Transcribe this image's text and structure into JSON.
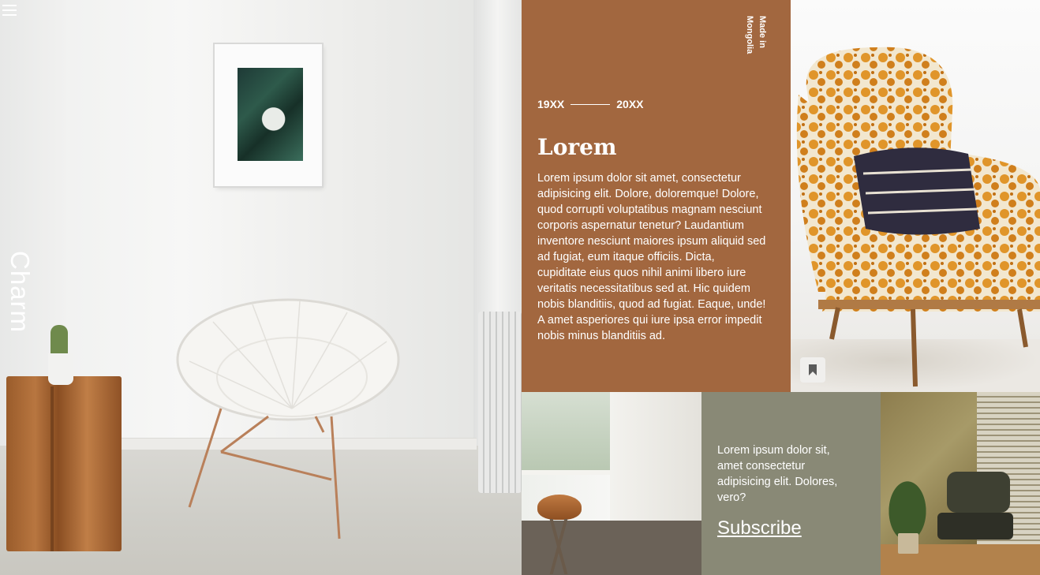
{
  "nav": {
    "menu_icon": "hamburger-menu-icon"
  },
  "hero": {
    "vertical_label": "Charm"
  },
  "info": {
    "made_in": "Made in Mongolia",
    "year_start": "19XX",
    "year_end": "20XX",
    "title": "Lorem",
    "body": "Lorem ipsum dolor sit amet, consectetur adipisicing elit. Dolore, doloremque! Dolore, quod corrupti voluptatibus magnam nesciunt corporis aspernatur tenetur? Laudantium inventore nesciunt maiores ipsum aliquid sed ad fugiat, eum itaque officiis. Dicta, cupiditate eius quos nihil animi libero iure veritatis necessitatibus sed at. Hic quidem nobis blanditiis, quod ad fugiat. Eaque, unde! A amet asperiores qui iure ipsa error impedit nobis minus blanditiis ad."
  },
  "armchair": {
    "bookmark_icon": "bookmark-icon"
  },
  "subscribe": {
    "text": "Lorem ipsum dolor sit, amet consectetur adipisicing elit. Dolores, vero?",
    "link_label": "Subscribe"
  },
  "colors": {
    "info_panel": "#a2673f",
    "subscribe_panel": "#898976",
    "text": "#ffffff"
  }
}
